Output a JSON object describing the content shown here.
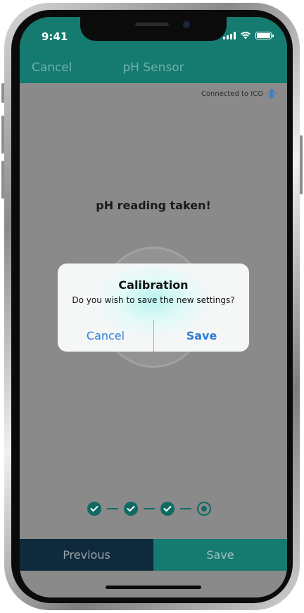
{
  "status_bar": {
    "time": "9:41"
  },
  "nav": {
    "cancel_label": "Cancel",
    "title": "pH Sensor"
  },
  "connection": {
    "text": "Connected to ICO",
    "icon": "bluetooth-icon"
  },
  "main": {
    "reading_text": "pH reading taken!"
  },
  "progress": {
    "completed_steps": 3,
    "total_steps": 4,
    "current_step": 4
  },
  "bottom_bar": {
    "previous_label": "Previous",
    "save_label": "Save"
  },
  "dialog": {
    "title": "Calibration",
    "message": "Do you wish to save the new settings?",
    "cancel_label": "Cancel",
    "save_label": "Save"
  },
  "colors": {
    "accent": "#157a70",
    "dark": "#0f2a3c",
    "link": "#2f7dd6"
  }
}
